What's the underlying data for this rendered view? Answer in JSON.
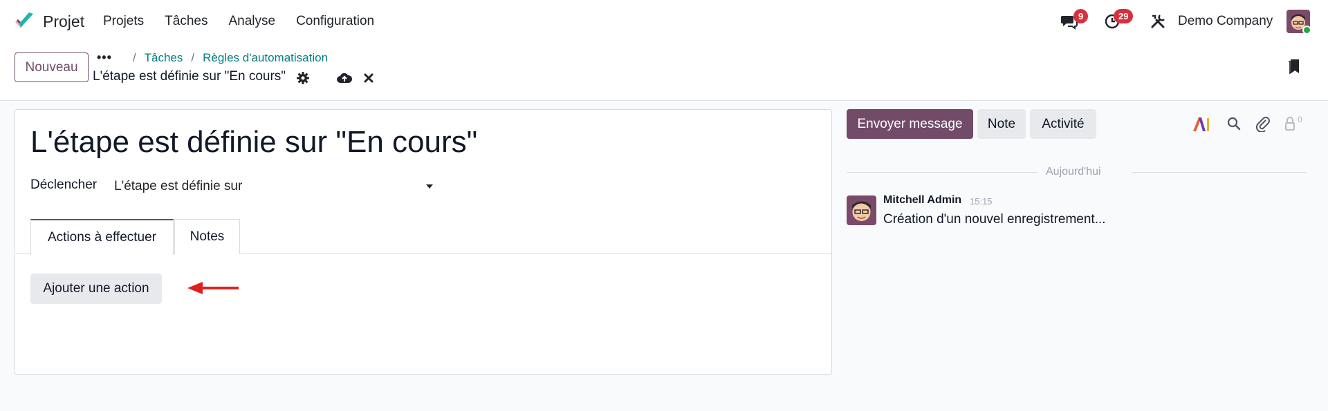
{
  "navbar": {
    "app_name": "Projet",
    "menu": [
      "Projets",
      "Tâches",
      "Analyse",
      "Configuration"
    ],
    "messages_badge": "9",
    "activities_badge": "29",
    "company": "Demo Company"
  },
  "control": {
    "new_button": "Nouveau",
    "breadcrumb_dots": "•••",
    "breadcrumb_1": "Tâches",
    "breadcrumb_2": "Règles d'automatisation",
    "record_title": "L'étape est définie sur \"En cours\""
  },
  "form": {
    "name": "L'étape est définie sur \"En cours\"",
    "trigger_label": "Déclencher",
    "trigger_value": "L'étape est définie sur",
    "tabs": [
      "Actions à effectuer",
      "Notes"
    ],
    "add_action_button": "Ajouter une action"
  },
  "chatter": {
    "send_message": "Envoyer message",
    "note": "Note",
    "activity": "Activité",
    "followers_count": "0",
    "today": "Aujourd'hui",
    "message": {
      "author": "Mitchell Admin",
      "time": "15:15",
      "body": "Création d'un nouvel enregistrement..."
    }
  },
  "colors": {
    "brand": "#714b67",
    "link": "#017e84",
    "badge": "#d9303e",
    "annotation_arrow": "#e02020"
  }
}
